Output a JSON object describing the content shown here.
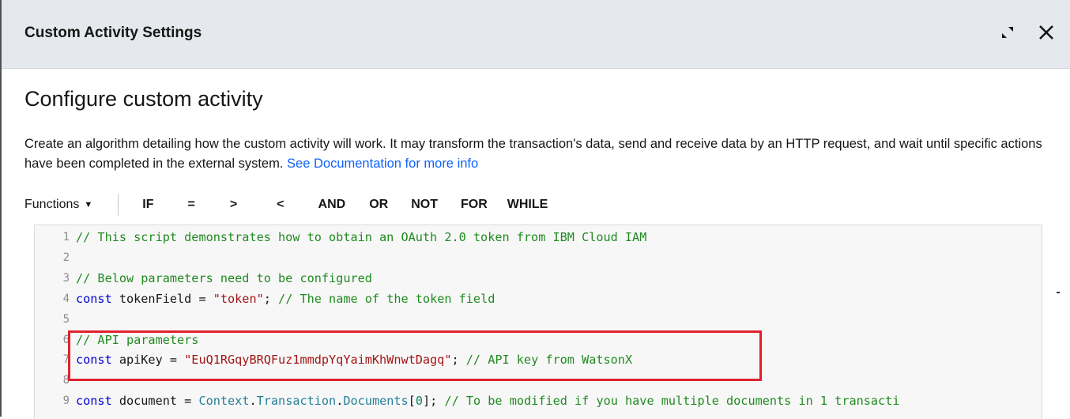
{
  "dialog": {
    "title": "Custom Activity Settings",
    "expand_icon": "expand-icon",
    "close_icon": "close-icon"
  },
  "section": {
    "title": "Configure custom activity",
    "description": "Create an algorithm detailing how the custom activity will work. It may transform the transaction's data, send and receive data by an HTTP request, and wait until specific actions have been completed in the external system.",
    "doc_link": "See Documentation for more info"
  },
  "toolbar": {
    "functions_label": "Functions",
    "buttons": [
      "IF",
      "=",
      ">",
      "<",
      "AND",
      "OR",
      "NOT",
      "FOR",
      "WHILE"
    ]
  },
  "editor": {
    "line_numbers": [
      "1",
      "2",
      "3",
      "4",
      "5",
      "6",
      "7",
      "8",
      "9"
    ],
    "lines": [
      [
        {
          "t": "comment",
          "v": "// This script demonstrates how to obtain an OAuth 2.0 token from IBM Cloud IAM"
        }
      ],
      [],
      [
        {
          "t": "comment",
          "v": "// Below parameters need to be configured"
        }
      ],
      [
        {
          "t": "keyword",
          "v": "const"
        },
        {
          "t": "ident",
          "v": " tokenField = "
        },
        {
          "t": "string",
          "v": "\"token\""
        },
        {
          "t": "ident",
          "v": "; "
        },
        {
          "t": "comment",
          "v": "// The name of the token field"
        }
      ],
      [],
      [
        {
          "t": "comment",
          "v": "// API parameters"
        }
      ],
      [
        {
          "t": "keyword",
          "v": "const"
        },
        {
          "t": "ident",
          "v": " apiKey = "
        },
        {
          "t": "string",
          "v": "\"EuQ1RGqyBRQFuz1mmdpYqYaimKhWnwtDagq\""
        },
        {
          "t": "ident",
          "v": "; "
        },
        {
          "t": "comment",
          "v": "// API key from WatsonX"
        }
      ],
      [],
      [
        {
          "t": "keyword",
          "v": "const"
        },
        {
          "t": "ident",
          "v": " document = "
        },
        {
          "t": "builtin",
          "v": "Context"
        },
        {
          "t": "ident",
          "v": "."
        },
        {
          "t": "builtin",
          "v": "Transaction"
        },
        {
          "t": "ident",
          "v": "."
        },
        {
          "t": "builtin",
          "v": "Documents"
        },
        {
          "t": "ident",
          "v": "["
        },
        {
          "t": "number",
          "v": "0"
        },
        {
          "t": "ident",
          "v": "]; "
        },
        {
          "t": "comment",
          "v": "// To be modified if you have multiple documents in 1 transacti"
        }
      ]
    ]
  },
  "colors": {
    "header_bg": "#e5e8ec",
    "link": "#0f62fe",
    "highlight_border": "#e0212f",
    "comment": "#218a21",
    "keyword": "#0000d6",
    "string": "#a31515"
  }
}
